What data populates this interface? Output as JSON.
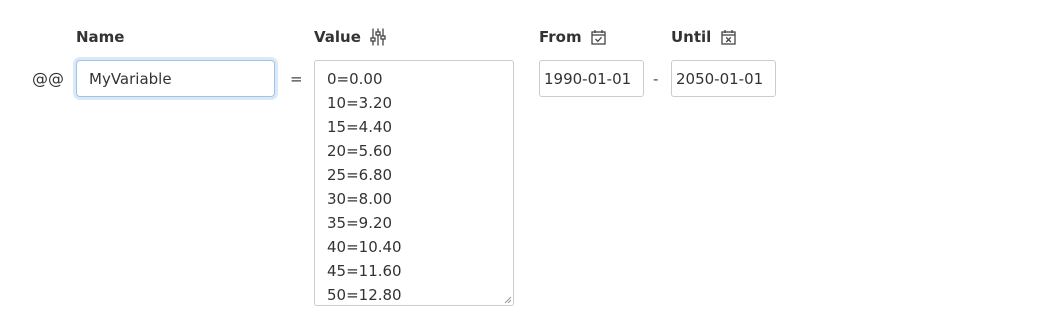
{
  "form": {
    "prefix": "@@",
    "equals": "=",
    "dash": "-",
    "headers": {
      "name": "Name",
      "value": "Value",
      "from": "From",
      "until": "Until"
    },
    "icons": {
      "value": "sliders-icon",
      "from": "calendar-check-icon",
      "until": "calendar-x-icon"
    },
    "name_value": "MyVariable",
    "value_lines": [
      "0=0.00",
      "10=3.20",
      "15=4.40",
      "20=5.60",
      "25=6.80",
      "30=8.00",
      "35=9.20",
      "40=10.40",
      "45=11.60",
      "50=12.80"
    ],
    "from_value": "1990-01-01",
    "until_value": "2050-01-01"
  },
  "colors": {
    "text": "#333333",
    "focus_border": "#9ec5e8",
    "border": "#cccccc"
  }
}
